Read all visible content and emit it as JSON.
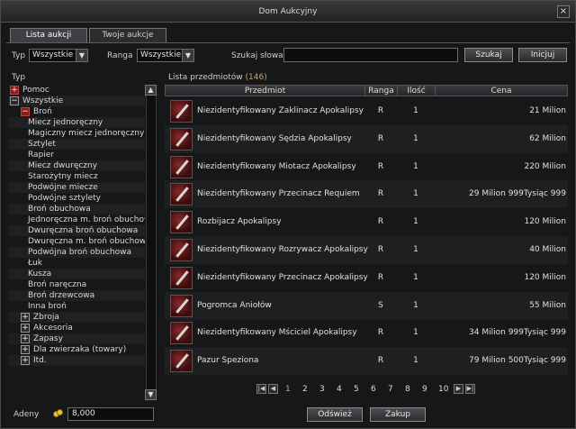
{
  "window": {
    "title": "Dom Aukcyjny",
    "close_icon": "×"
  },
  "tabs": [
    {
      "label": "Lista aukcji",
      "active": true
    },
    {
      "label": "Twoje aukcje",
      "active": false
    }
  ],
  "filters": {
    "type_label": "Typ",
    "type_value": "Wszystkie",
    "rank_label": "Ranga",
    "rank_value": "Wszystkie",
    "search_label": "Szukaj słowa",
    "search_value": "",
    "search_button": "Szukaj",
    "reset_button": "Inicjuj"
  },
  "tree": {
    "header": "Typ",
    "items": [
      {
        "label": "Pomoc",
        "depth": 0,
        "box": "+",
        "red": true
      },
      {
        "label": "Wszystkie",
        "depth": 0,
        "box": "−",
        "red": false
      },
      {
        "label": "Broń",
        "depth": 1,
        "box": "−",
        "red": true
      },
      {
        "label": "Miecz jednoręczny",
        "depth": 2
      },
      {
        "label": "Magiczny miecz jednoręczny",
        "depth": 2
      },
      {
        "label": "Sztylet",
        "depth": 2
      },
      {
        "label": "Rapier",
        "depth": 2
      },
      {
        "label": "Miecz dwuręczny",
        "depth": 2
      },
      {
        "label": "Starożytny miecz",
        "depth": 2
      },
      {
        "label": "Podwójne miecze",
        "depth": 2
      },
      {
        "label": "Podwójne sztylety",
        "depth": 2
      },
      {
        "label": "Broń obuchowa",
        "depth": 2
      },
      {
        "label": "Jednoręczna m. broń obuchowa",
        "depth": 2
      },
      {
        "label": "Dwuręczna broń obuchowa",
        "depth": 2
      },
      {
        "label": "Dwuręczna m. broń obuchowa",
        "depth": 2
      },
      {
        "label": "Podwójna broń obuchowa",
        "depth": 2
      },
      {
        "label": "Łuk",
        "depth": 2
      },
      {
        "label": "Kusza",
        "depth": 2
      },
      {
        "label": "Broń naręczna",
        "depth": 2
      },
      {
        "label": "Broń drzewcowa",
        "depth": 2
      },
      {
        "label": "Inna broń",
        "depth": 2
      },
      {
        "label": "Zbroja",
        "depth": 1,
        "box": "+"
      },
      {
        "label": "Akcesoria",
        "depth": 1,
        "box": "+"
      },
      {
        "label": "Zapasy",
        "depth": 1,
        "box": "+"
      },
      {
        "label": "Dla zwierzaka (towary)",
        "depth": 1,
        "box": "+"
      },
      {
        "label": "Itd.",
        "depth": 1,
        "box": "+"
      }
    ]
  },
  "list": {
    "title": "Lista przedmiotów",
    "count": "(146)",
    "columns": [
      "Przedmiot",
      "Ranga",
      "Ilość",
      "Cena"
    ],
    "rows": [
      {
        "name": "Niezidentyfikowany Zaklinacz Apokalipsy",
        "rank": "R",
        "qty": "1",
        "price": "21 Milion"
      },
      {
        "name": "Niezidentyfikowany Sędzia Apokalipsy",
        "rank": "R",
        "qty": "1",
        "price": "62 Milion"
      },
      {
        "name": "Niezidentyfikowany Miotacz Apokalipsy",
        "rank": "R",
        "qty": "1",
        "price": "220 Milion"
      },
      {
        "name": "Niezidentyfikowany Przecinacz Requiem",
        "rank": "R",
        "qty": "1",
        "price": "29 Milion 999Tysiąc 999"
      },
      {
        "name": "Rozbijacz Apokalipsy",
        "rank": "R",
        "qty": "1",
        "price": "120 Milion"
      },
      {
        "name": "Niezidentyfikowany Rozrywacz Apokalipsy",
        "rank": "R",
        "qty": "1",
        "price": "40 Milion"
      },
      {
        "name": "Niezidentyfikowany Przecinacz Apokalipsy",
        "rank": "R",
        "qty": "1",
        "price": "120 Milion"
      },
      {
        "name": "Pogromca Aniołów",
        "rank": "S",
        "qty": "1",
        "price": "55 Milion"
      },
      {
        "name": "Niezidentyfikowany Mściciel Apokalipsy",
        "rank": "R",
        "qty": "1",
        "price": "34 Milion 999Tysiąc 999"
      },
      {
        "name": "Pazur Speziona",
        "rank": "R",
        "qty": "1",
        "price": "79 Milion 500Tysiąc 999"
      }
    ]
  },
  "pagination": {
    "pages": [
      "1",
      "2",
      "3",
      "4",
      "5",
      "6",
      "7",
      "8",
      "9",
      "10"
    ],
    "current": "1",
    "first_icon": "|◀",
    "prev_icon": "◀",
    "next_icon": "▶",
    "last_icon": "▶|"
  },
  "footer": {
    "adena_label": "Adeny",
    "adena_value": "8,000",
    "refresh_button": "Odśwież",
    "buy_button": "Zakup"
  }
}
